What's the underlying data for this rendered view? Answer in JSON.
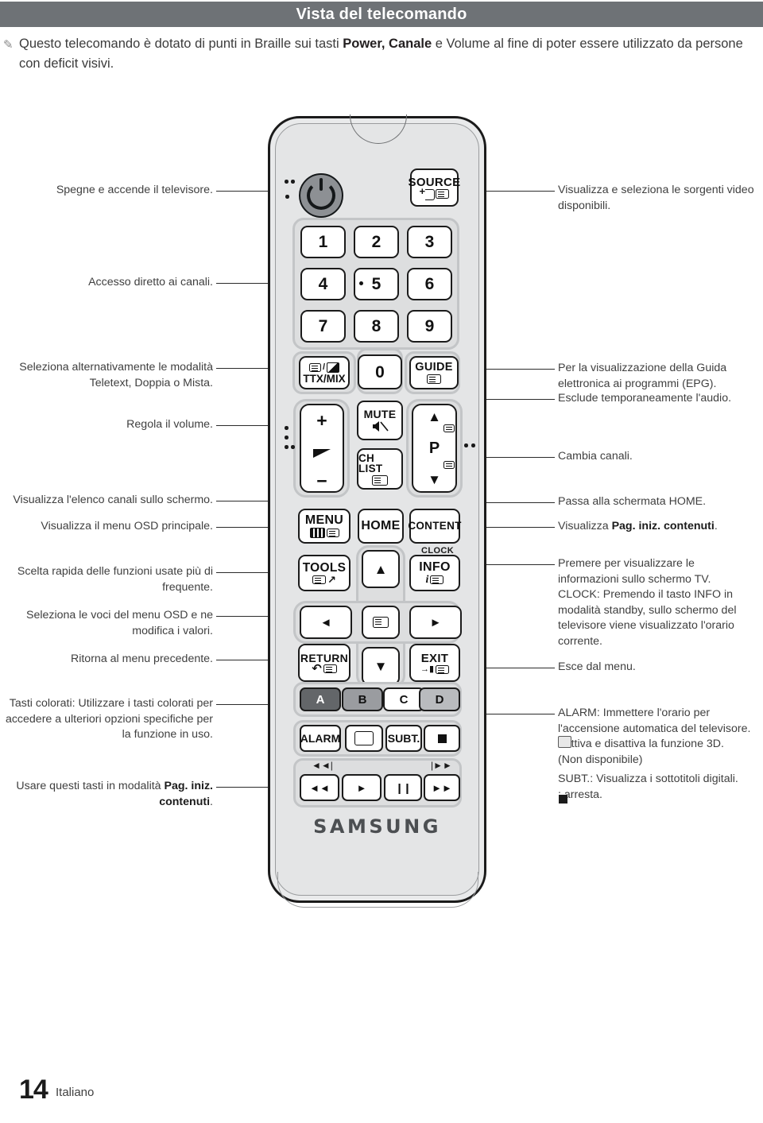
{
  "header": {
    "title": "Vista del telecomando"
  },
  "note": {
    "icon": "pencil-icon",
    "text_before": "Questo telecomando è dotato di punti in Braille sui tasti ",
    "bold": "Power, Canale",
    "text_after": " e Volume al fine di poter essere utilizzato da persone con deficit visivi."
  },
  "labels_left": [
    {
      "id": "power",
      "text": "Spegne e accende il televisore."
    },
    {
      "id": "numbers",
      "text": "Accesso diretto ai canali."
    },
    {
      "id": "ttxmix",
      "text": "Seleziona alternativamente le modalità Teletext, Doppia o Mista."
    },
    {
      "id": "volume",
      "text": "Regola il volume."
    },
    {
      "id": "chlist",
      "text": "Visualizza l'elenco canali sullo schermo."
    },
    {
      "id": "menu",
      "text": "Visualizza il menu OSD  principale."
    },
    {
      "id": "tools",
      "text": "Scelta rapida delle funzioni usate più di frequente."
    },
    {
      "id": "arrows",
      "text": "Seleziona le voci del menu OSD e ne modifica i valori."
    },
    {
      "id": "return",
      "text": "Ritorna al menu precedente."
    },
    {
      "id": "colorkeys",
      "text": "Tasti colorati: Utilizzare i tasti colorati per accedere a ulteriori opzioni specifiche per la funzione in uso."
    },
    {
      "id": "media",
      "text_before": "Usare questi tasti in modalità ",
      "bold": "Pag. iniz. contenuti",
      "text_after": "."
    }
  ],
  "labels_right": [
    {
      "id": "source",
      "text": "Visualizza e seleziona le sorgenti video disponibili."
    },
    {
      "id": "guide",
      "text": "Per la visualizzazione della Guida elettronica ai programmi (EPG)."
    },
    {
      "id": "mute",
      "text": "Esclude temporaneamente l'audio."
    },
    {
      "id": "channel",
      "text": "Cambia canali."
    },
    {
      "id": "home",
      "text": "Passa alla schermata HOME."
    },
    {
      "id": "content",
      "text_before": "Visualizza ",
      "bold": "Pag. iniz. contenuti",
      "text_after": "."
    },
    {
      "id": "info",
      "text": "Premere per visualizzare le informazioni sullo schermo TV.\nCLOCK: Premendo il tasto INFO in modalità standby, sullo schermo del televisore viene visualizzato l'orario corrente."
    },
    {
      "id": "exit",
      "text": "Esce dal menu."
    },
    {
      "id": "alarm",
      "text": "ALARM: Immettere l'orario per l'accensione automatica del televisore.\n: Attiva e disattiva la funzione 3D.\n(Non disponibile)"
    },
    {
      "id": "subt",
      "text": "SUBT.: Visualizza i sottotitoli digitali.\n : arresta."
    }
  ],
  "remote": {
    "brand": "SAMSUNG",
    "source_key": {
      "label": "SOURCE",
      "icons": [
        "input-arrow-icon",
        "list-panel-icon"
      ]
    },
    "numbers": [
      "1",
      "2",
      "3",
      "4",
      "5",
      "6",
      "7",
      "8",
      "9"
    ],
    "zero_key": "0",
    "ttxmix_key": {
      "label": "TTX/MIX",
      "icons": [
        "teletext-icon",
        "mix-icon"
      ]
    },
    "guide_key": {
      "label": "GUIDE",
      "icons": [
        "guide-panel-icon"
      ]
    },
    "volume": {
      "plus": "+",
      "minus": "−",
      "icon": "volume-wedge-icon"
    },
    "mute_key": {
      "label": "MUTE",
      "icons": [
        "mute-speaker-icon"
      ]
    },
    "chlist_key": {
      "label": "CH LIST",
      "icons": [
        "ch-list-panel-icon"
      ]
    },
    "channel": {
      "label": "P",
      "up": "▲",
      "down": "▼",
      "icons": [
        "prev-page-icon",
        "next-page-icon"
      ]
    },
    "menu_key": {
      "label": "MENU",
      "icons": [
        "columns-icon",
        "menu-panel-icon"
      ]
    },
    "home_key": {
      "label": "HOME"
    },
    "content_key": {
      "label": "CONTENT",
      "above": "CLOCK"
    },
    "tools_key": {
      "label": "TOOLS",
      "icons": [
        "tools-panel-icon",
        "shortcut-arrow-icon"
      ]
    },
    "info_key": {
      "label": "INFO",
      "icons": [
        "italic-i-icon",
        "info-panel-icon"
      ]
    },
    "dpad": {
      "up": "▲",
      "down": "▼",
      "left": "◄",
      "right": "►",
      "enter": "enter-icon"
    },
    "return_key": {
      "label": "RETURN",
      "icons": [
        "return-arrow-icon",
        "return-panel-icon"
      ]
    },
    "exit_key": {
      "label": "EXIT",
      "icons": [
        "exit-door-icon",
        "exit-panel-icon"
      ]
    },
    "color_keys": [
      {
        "label": "A",
        "color": "#636669"
      },
      {
        "label": "B",
        "color": "#9a9ca0"
      },
      {
        "label": "C",
        "color": "#ffffff"
      },
      {
        "label": "D",
        "color": "#b9bbbe"
      }
    ],
    "function_keys": [
      {
        "label": "ALARM",
        "icon": ""
      },
      {
        "label": "",
        "icon": "3d-glasses-icon"
      },
      {
        "label": "SUBT.",
        "icon": ""
      },
      {
        "label": "",
        "icon": "stop-square-icon"
      }
    ],
    "media_top": {
      "prev": "◄◄|",
      "next": "|►►"
    },
    "media_keys": [
      {
        "label": "◄◄",
        "name": "rewind"
      },
      {
        "label": "►",
        "name": "play"
      },
      {
        "label": "❙❙",
        "name": "pause"
      },
      {
        "label": "►►",
        "name": "fast-forward"
      }
    ]
  },
  "footer": {
    "page": "14",
    "language": "Italiano"
  },
  "colors": {
    "header_bar": "#6e7276",
    "remote_body": "#e9eaeb",
    "outline": "#1b1b1b"
  }
}
